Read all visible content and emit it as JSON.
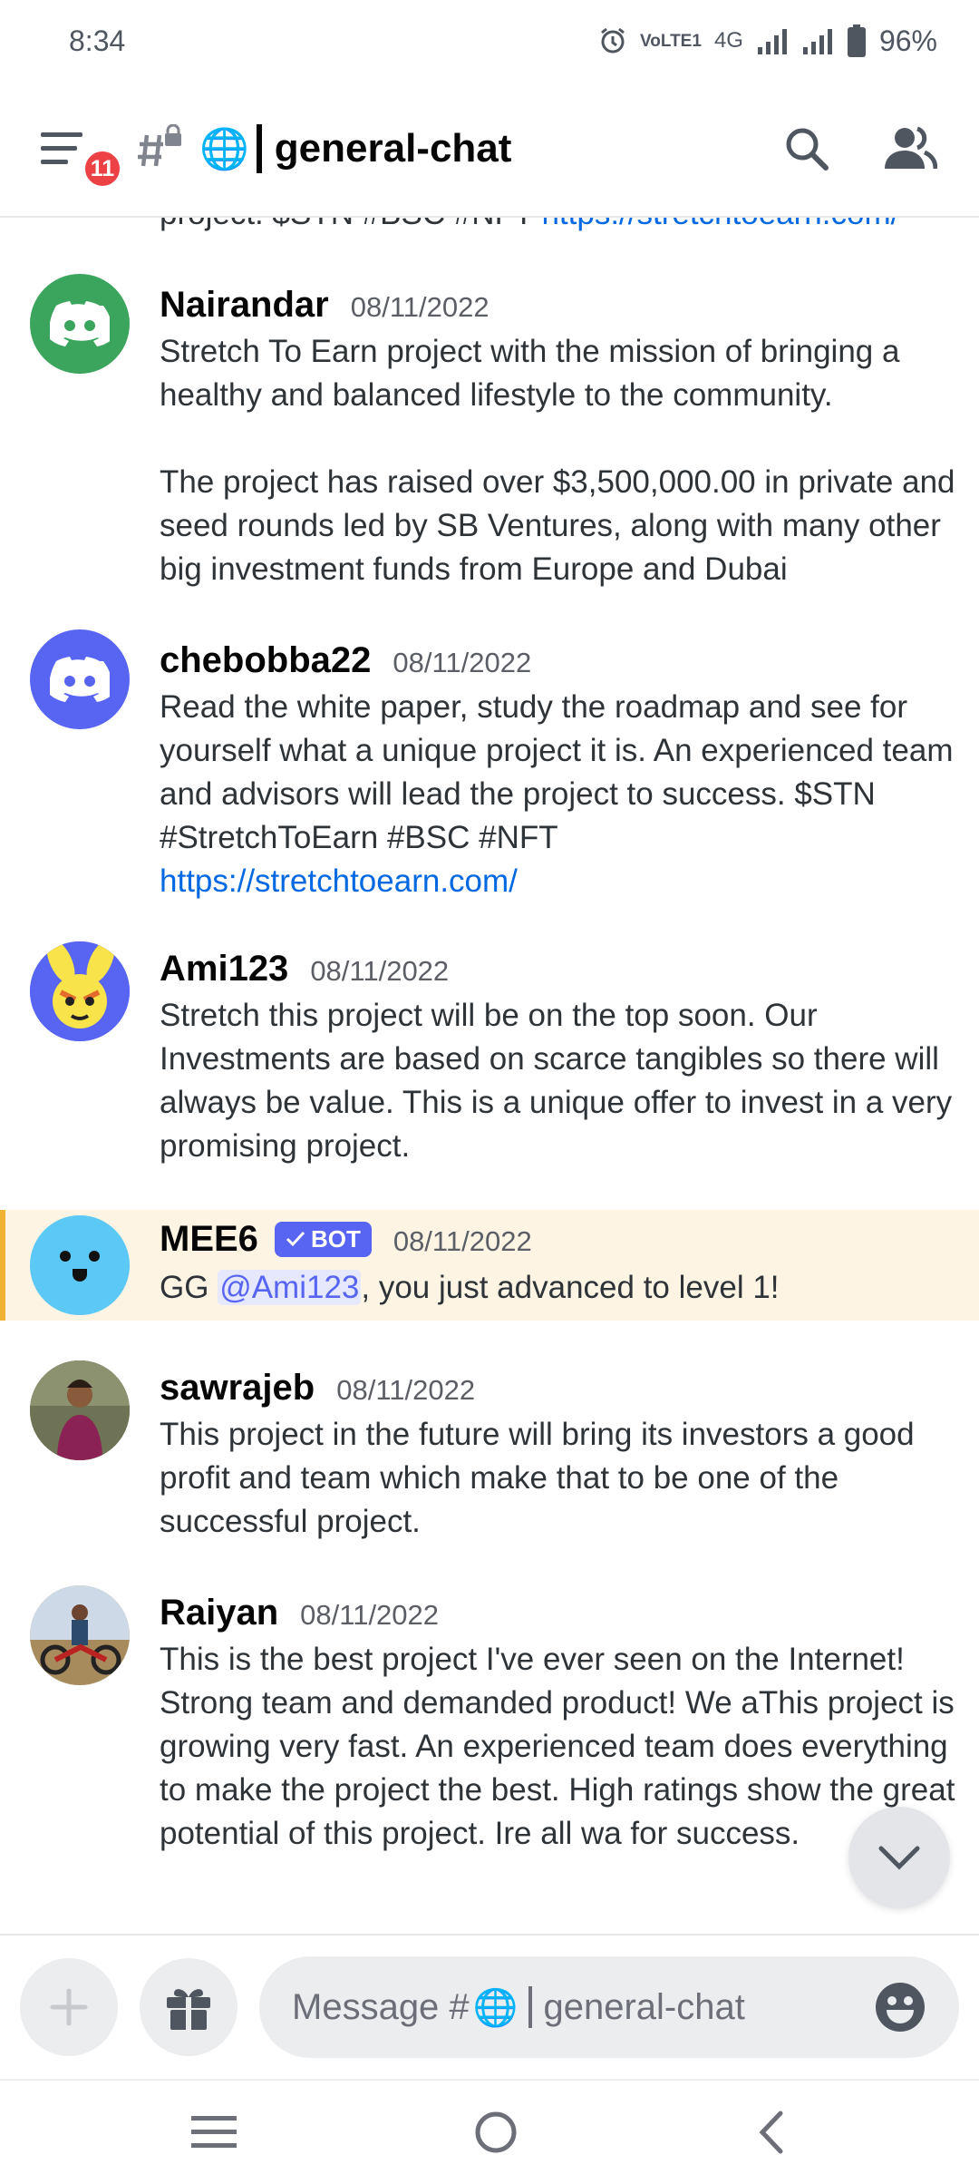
{
  "status_bar": {
    "time": "8:34",
    "network_lte": "VoLTE1",
    "network_type": "4G",
    "battery": "96%"
  },
  "header": {
    "unread_badge": "11",
    "channel_name": "general-chat",
    "globe": "🌐"
  },
  "clipped_line": {
    "text": "project. $STN #BSC #NFT ",
    "link": "https://stretchtoearn.com/"
  },
  "messages": [
    {
      "author": "Nairandar",
      "time": "08/11/2022",
      "paragraphs": [
        "Stretch To Earn project with the mission of bringing a healthy and balanced lifestyle to the community.",
        "The project has raised over $3,500,000.00 in private and seed rounds led by SB Ventures, along with many other big investment funds from Europe and Dubai"
      ],
      "avatar_color": "#3ba55d"
    },
    {
      "author": "chebobba22",
      "time": "08/11/2022",
      "text": "Read the white paper, study the roadmap and see for yourself what a unique project it is. An experienced team and advisors will lead the project to success. $STN #StretchToEarn #BSC #NFT",
      "link": "https://stretchtoearn.com/",
      "avatar_color": "#5865f2"
    },
    {
      "author": "Ami123",
      "time": "08/11/2022",
      "text": "Stretch  this project will be on the top soon. Our Investments are based on scarce tangibles so there will always be value. This is a unique offer to invest in a very promising project."
    },
    {
      "author": "MEE6",
      "bot_tag": "BOT",
      "time": "08/11/2022",
      "text_before": "GG ",
      "mention": "@Ami123",
      "text_after": ", you just advanced to level 1!",
      "avatar_color": "#5bc8f5"
    },
    {
      "author": "sawrajeb",
      "time": "08/11/2022",
      "text": "This project in the future will bring its investors a good profit and  team which make that to be one of the successful project."
    },
    {
      "author": "Raiyan",
      "time": "08/11/2022",
      "text": "This is the best project I've ever seen on the Internet! Strong team and demanded product! We aThis project is growing very fast. An experienced team does everything to make the project the best. High ratings show the great potential of this project. Ire all wa for success."
    }
  ],
  "composer": {
    "placeholder_prefix": "Message #",
    "placeholder_globe": "🌐",
    "placeholder_channel": "general-chat"
  },
  "colors": {
    "accent": "#5865f2",
    "badge": "#ed4245",
    "highlight": "#fdf4e3",
    "highlight_border": "#f0b232",
    "link": "#0068e0"
  }
}
